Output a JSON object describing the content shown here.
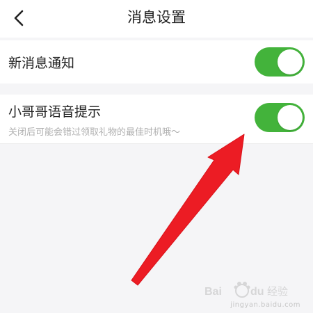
{
  "header": {
    "title": "消息设置"
  },
  "settings": [
    {
      "label": "新消息通知",
      "enabled": true
    },
    {
      "label": "小哥哥语音提示",
      "description": "关闭后可能会错过领取礼物的最佳时机哦～",
      "enabled": true
    }
  ],
  "colors": {
    "switch_on": "#43b33b",
    "annotation_arrow": "#ec1c24"
  },
  "watermark": {
    "text": "Bai du 经验",
    "url_text": "jingyan.baidu.com"
  }
}
